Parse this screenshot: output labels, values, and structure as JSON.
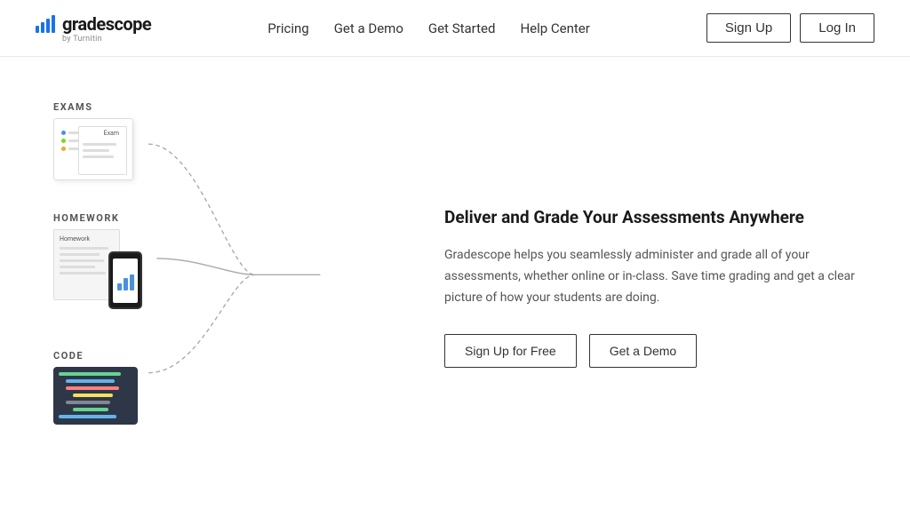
{
  "header": {
    "logo_text": "gradescope",
    "logo_sub": "by Turnitin",
    "nav": {
      "items": [
        {
          "label": "Pricing",
          "id": "pricing"
        },
        {
          "label": "Get a Demo",
          "id": "get-a-demo"
        },
        {
          "label": "Get Started",
          "id": "get-started"
        },
        {
          "label": "Help Center",
          "id": "help-center"
        }
      ],
      "btn_signup": "Sign Up",
      "btn_login": "Log In"
    }
  },
  "diagram": {
    "exams_label": "EXAMS",
    "homework_label": "HOMEWORK",
    "code_label": "CODE",
    "hw_paper_label": "Homework",
    "exam_tag": "Exam"
  },
  "main": {
    "title": "Deliver and Grade Your Assessments Anywhere",
    "description": "Gradescope helps you seamlessly administer and grade all of your assessments, whether online or in-class. Save time grading and get a clear picture of how your students are doing.",
    "btn_signup": "Sign Up for Free",
    "btn_demo": "Get a Demo"
  }
}
